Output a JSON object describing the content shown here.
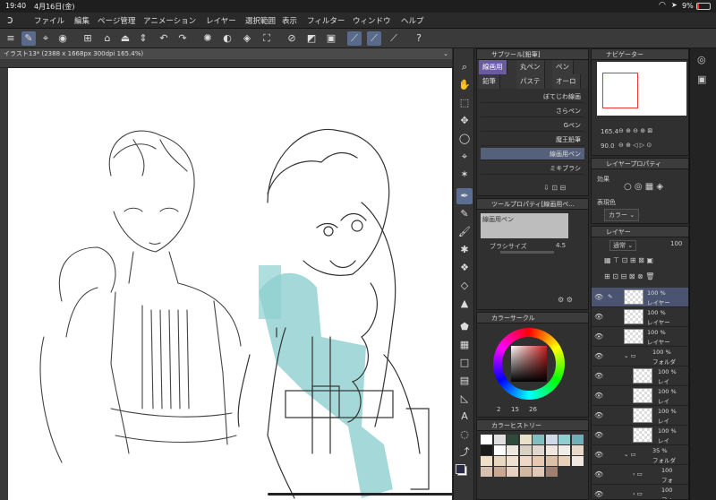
{
  "status": {
    "time": "19:40",
    "date": "4月16日(金)",
    "battery": "9%"
  },
  "menu": [
    "ファイル",
    "編集",
    "ページ管理",
    "アニメーション",
    "レイヤー",
    "選択範囲",
    "表示",
    "フィルター",
    "ウィンドウ",
    "ヘルプ"
  ],
  "document": {
    "tab": "イラスト13* (2388 x 1668px 300dpi 165.4%)"
  },
  "subtool": {
    "header": "サブツール[鉛筆]",
    "tabs": [
      "線画用",
      "丸ペン",
      "ペン",
      "鉛筆",
      "パステ",
      "オーロ"
    ],
    "brushes": [
      "ぼてじわ線画",
      "さらペン",
      "Gペン",
      "魔王鉛筆",
      "線画用ペン",
      "ミキブラシ"
    ],
    "selected_brush": "線画用ペン"
  },
  "toolprop": {
    "header": "ツールプロパティ[線画用ペ...",
    "brush_name": "線画用ペン",
    "size_label": "ブラシサイズ",
    "size_value": "4.5"
  },
  "colorcircle": {
    "header": "カラーサークル",
    "values": [
      "2",
      "15",
      "26"
    ]
  },
  "colorhistory": {
    "header": "カラーヒストリー"
  },
  "navigator": {
    "header": "ナビゲーター",
    "zoom": "165.4",
    "angle": "90.0"
  },
  "layerprop": {
    "header": "レイヤープロパティ",
    "effect_label": "効果",
    "expression_label": "表現色",
    "expression_value": "カラー"
  },
  "layers": {
    "header": "レイヤー",
    "blend": "通常",
    "opacity": "100",
    "items": [
      {
        "pct": "100 %",
        "name": "レイヤー"
      },
      {
        "pct": "100 %",
        "name": "レイヤー"
      },
      {
        "pct": "100 %",
        "name": "レイヤー"
      },
      {
        "pct": "100 %",
        "name": "フォルダ"
      },
      {
        "pct": "100 %",
        "name": "レイ"
      },
      {
        "pct": "100 %",
        "name": "レイ"
      },
      {
        "pct": "100 %",
        "name": "レイ"
      },
      {
        "pct": "100 %",
        "name": "レイ"
      },
      {
        "pct": "35 %",
        "name": "フォルダ"
      },
      {
        "pct": "100",
        "name": "フォ"
      },
      {
        "pct": "100",
        "name": "フォ"
      }
    ]
  },
  "history_colors": [
    "#ffffff",
    "#e0e0e0",
    "#2f4a3a",
    "#e8e0c8",
    "#7fbfbf",
    "#cfd9e8",
    "#8fcfcf",
    "#6fb0b8",
    "#1a1a1a",
    "#ffffff",
    "#ece8e0",
    "#d8d0c0",
    "#e0d8d0",
    "#f0e8e0",
    "#f0ece8",
    "#e8d8c8",
    "#f0e0c8",
    "#e8d8c0",
    "#f0e0d0",
    "#f0d8c8",
    "#e8c8b0",
    "#dcc0a8",
    "#e8d0b8",
    "#f0e8e0",
    "#d8c0b0",
    "#c8a890",
    "#e8d0c0",
    "#d0b8a0",
    "#e0c8b8",
    "#a08070"
  ]
}
